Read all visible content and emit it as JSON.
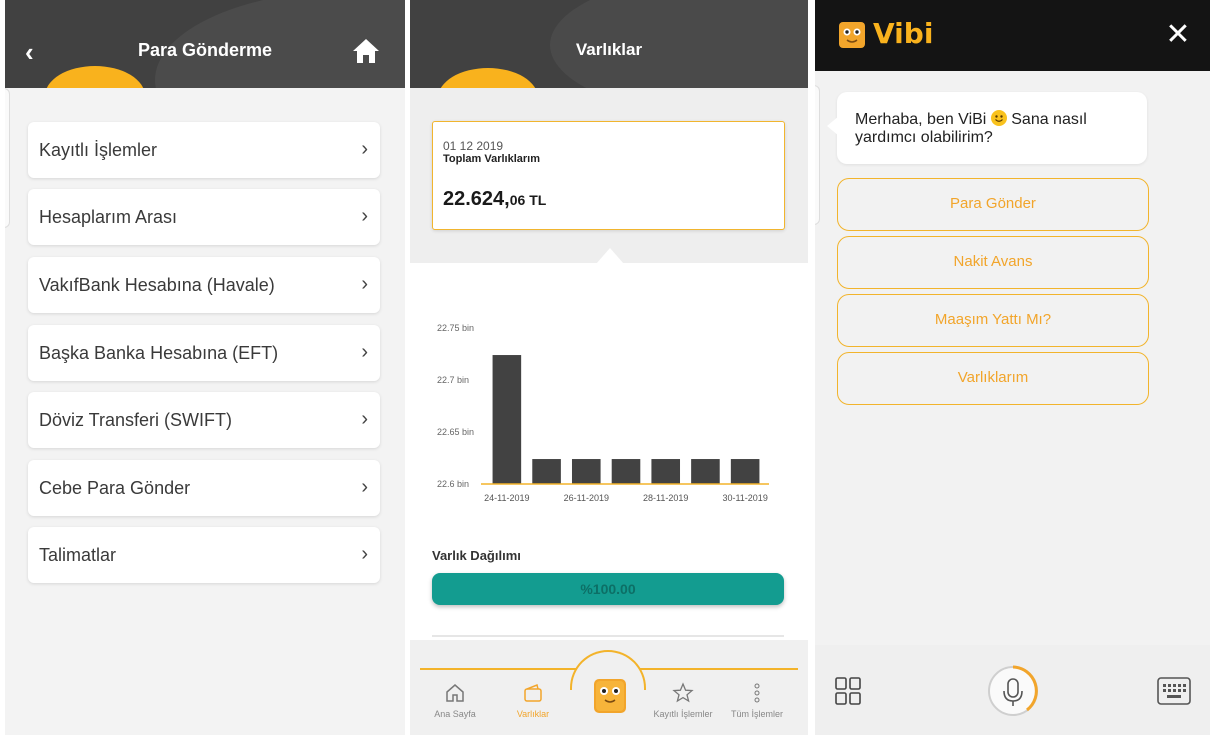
{
  "transfer": {
    "title": "Para Gönderme",
    "back": "‹",
    "items": [
      {
        "label": "Kayıtlı İşlemler"
      },
      {
        "label": "Hesaplarım Arası"
      },
      {
        "label": "VakıfBank Hesabına (Havale)"
      },
      {
        "label": "Başka Banka Hesabına (EFT)"
      },
      {
        "label": "Döviz Transferi (SWIFT)"
      },
      {
        "label": "Cebe Para Gönder"
      },
      {
        "label": "Talimatlar"
      }
    ],
    "chevron": "›"
  },
  "assets": {
    "title": "Varlıklar",
    "card": {
      "date": "01 12 2019",
      "label": "Toplam Varlıklarım",
      "amount_int": "22.624,",
      "amount_dec": "06 TL"
    },
    "distribution_title": "Varlık Dağılımı",
    "distribution_value": "%100.00",
    "nav": [
      {
        "label": "Ana Sayfa",
        "icon": "home-icon"
      },
      {
        "label": "Varlıklar",
        "icon": "wallet-icon"
      },
      {
        "label": "Kayıtlı İşlemler",
        "icon": "star-icon"
      },
      {
        "label": "Tüm İşlemler",
        "icon": "more-vertical-icon"
      }
    ]
  },
  "chart_data": {
    "type": "bar",
    "categories": [
      "24-11-2019",
      "25-11-2019",
      "26-11-2019",
      "27-11-2019",
      "28-11-2019",
      "29-11-2019",
      "30-11-2019"
    ],
    "values": [
      22.724,
      22.624,
      22.624,
      22.624,
      22.624,
      22.624,
      22.624
    ],
    "x_tick_labels": [
      "24-11-2019",
      "26-11-2019",
      "28-11-2019",
      "30-11-2019"
    ],
    "y_tick_labels": [
      "22.75 bin",
      "22.7 bin",
      "22.65 bin",
      "22.6 bin"
    ],
    "y_ticks": [
      22.75,
      22.7,
      22.65,
      22.6
    ],
    "ylim": [
      22.6,
      22.75
    ],
    "bar_color": "#424242",
    "baseline_color": "#f3b32a",
    "grid": false
  },
  "vibi": {
    "brand": "Vibi",
    "close": "✕",
    "greeting_1": "Merhaba, ben ViBi",
    "greeting_2": " Sana nasıl yardımcı olabilirim?",
    "options": [
      {
        "label": "Para Gönder"
      },
      {
        "label": "Nakit Avans"
      },
      {
        "label": "Maaşım Yattı Mı?"
      },
      {
        "label": "Varlıklarım"
      }
    ]
  },
  "colors": {
    "accent": "#f9b21d",
    "header": "#414141",
    "teal": "#139c90"
  }
}
